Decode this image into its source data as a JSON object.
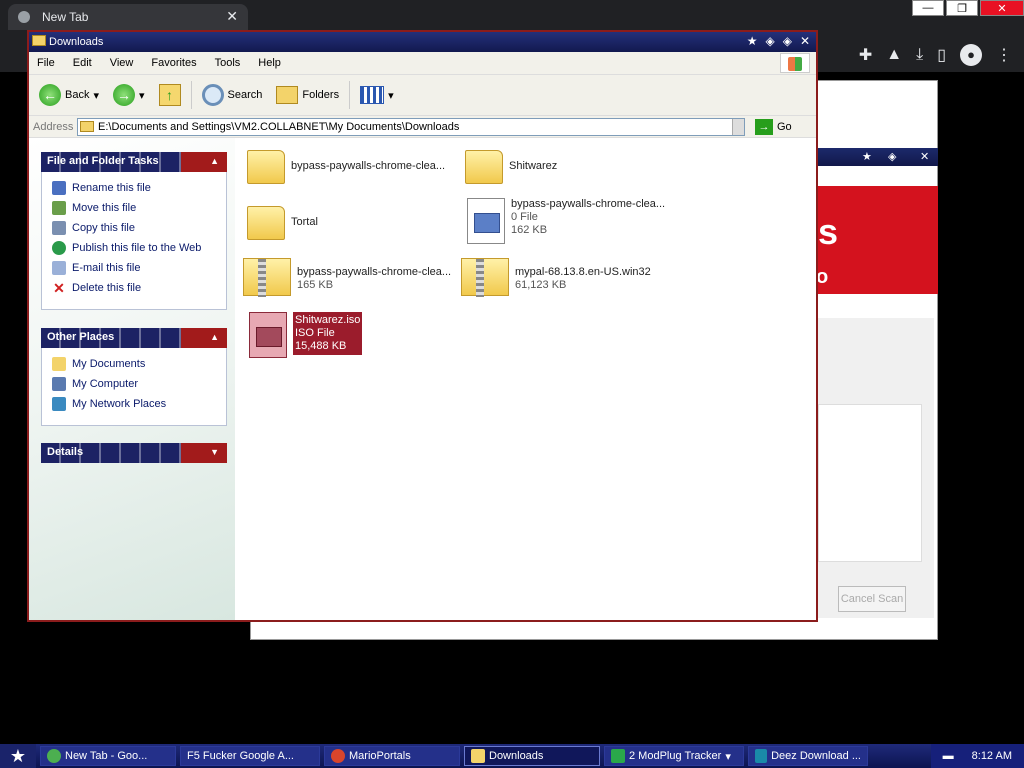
{
  "chrome": {
    "tab_title": "New Tab",
    "tab_close": "✕",
    "caption_min": "—",
    "caption_max": "❐",
    "caption_close": "✕",
    "toolbar_icons": [
      "puzzle-icon",
      "flask-icon",
      "download-icon",
      "sidebar-icon",
      "profile-icon",
      "menu-icon"
    ]
  },
  "background_window": {
    "cancel_label": "Cancel Scan"
  },
  "explorer": {
    "title": "Downloads",
    "menu": [
      "File",
      "Edit",
      "View",
      "Favorites",
      "Tools",
      "Help"
    ],
    "toolbar": {
      "back": "Back",
      "search": "Search",
      "folders": "Folders"
    },
    "address": {
      "label": "Address",
      "path": "E:\\Documents and Settings\\VM2.COLLABNET\\My Documents\\Downloads",
      "go": "Go"
    },
    "tasks": {
      "header": "File and Folder Tasks",
      "items": [
        "Rename this file",
        "Move this file",
        "Copy this file",
        "Publish this file to the Web",
        "E-mail this file",
        "Delete this file"
      ]
    },
    "places": {
      "header": "Other Places",
      "items": [
        "My Documents",
        "My Computer",
        "My Network Places"
      ]
    },
    "details": {
      "header": "Details"
    },
    "files": [
      {
        "name": "bypass-paywalls-chrome-clea...",
        "type": "",
        "size": ""
      },
      {
        "name": "Shitwarez",
        "type": "",
        "size": ""
      },
      {
        "name": "Tortal",
        "type": "",
        "size": ""
      },
      {
        "name": "bypass-paywalls-chrome-clea...",
        "type": "0 File",
        "size": "162 KB"
      },
      {
        "name": "bypass-paywalls-chrome-clea...",
        "type": "",
        "size": "165 KB"
      },
      {
        "name": "mypal-68.13.8.en-US.win32",
        "type": "",
        "size": "61,123 KB"
      },
      {
        "name": "Shitwarez.iso",
        "type": "ISO File",
        "size": "15,488 KB"
      }
    ]
  },
  "taskbar": {
    "start": "★",
    "tasks": [
      "New Tab - Goo...",
      "F5 Fucker Google A...",
      "MarioPortals",
      "Downloads",
      "2 ModPlug Tracker",
      "Deez Download ..."
    ],
    "clock": "8:12 AM"
  }
}
